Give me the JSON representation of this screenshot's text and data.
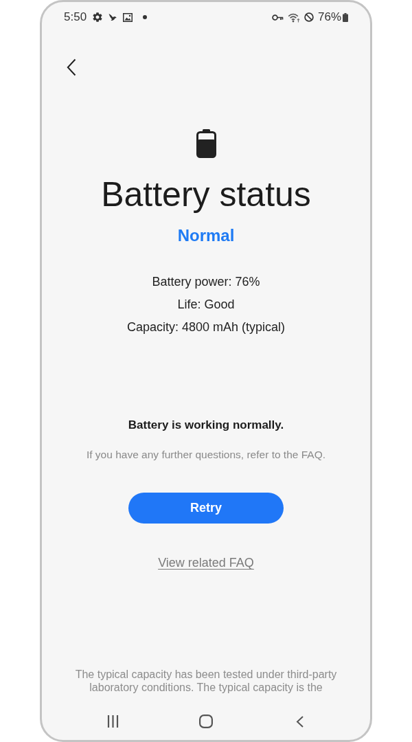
{
  "status_bar": {
    "time": "5:50",
    "battery_percent": "76%"
  },
  "title": "Battery status",
  "status": "Normal",
  "details": [
    "Battery power: 76%",
    "Life: Good",
    "Capacity: 4800 mAh (typical)"
  ],
  "message": "Battery is working normally.",
  "hint": "If you have any further questions, refer to the FAQ.",
  "retry_button": "Retry",
  "faq_link": "View related FAQ",
  "footnote": "The typical capacity has been tested under third-party laboratory conditions. The typical capacity is the"
}
